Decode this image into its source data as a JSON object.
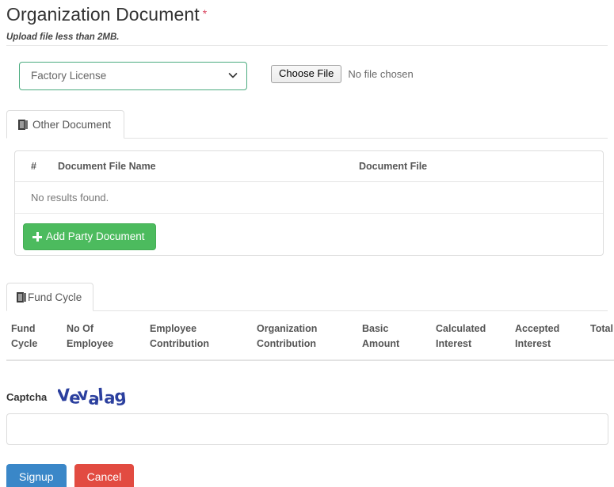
{
  "header": {
    "title": "Organization Document",
    "required_marker": "*",
    "subtitle": "Upload file less than 2MB."
  },
  "upload": {
    "document_type": {
      "selected": "Factory License",
      "options": [
        "Factory License"
      ],
      "icon": "chevron-down-icon",
      "border_color": "#4bab7f"
    },
    "file_input": {
      "button_label": "Choose File",
      "status_text": "No file chosen"
    }
  },
  "other_document": {
    "tab": {
      "label": "Other Document",
      "icon": "book-icon"
    },
    "table": {
      "columns": [
        "#",
        "Document File Name",
        "Document File"
      ],
      "rows": [],
      "empty_message": "No results found."
    },
    "add_button": {
      "label": "Add Party Document",
      "icon": "plus-icon",
      "color": "#4cbb5e"
    }
  },
  "fund_cycle": {
    "tab": {
      "label": "Fund Cycle",
      "icon": "book-icon"
    },
    "table": {
      "columns": [
        "Fund Cycle",
        "No Of Employee",
        "Employee Contribution",
        "Organization Contribution",
        "Basic Amount",
        "Calculated Interest",
        "Accepted Interest",
        "Total"
      ],
      "rows": []
    }
  },
  "captcha": {
    "label": "Captcha",
    "image_text": "Vevalag",
    "image_color": "#2b3f9e",
    "input_value": "",
    "input_placeholder": ""
  },
  "footer": {
    "signup_label": "Signup",
    "cancel_label": "Cancel",
    "signup_color": "#3a87c8",
    "cancel_color": "#e24b41"
  }
}
